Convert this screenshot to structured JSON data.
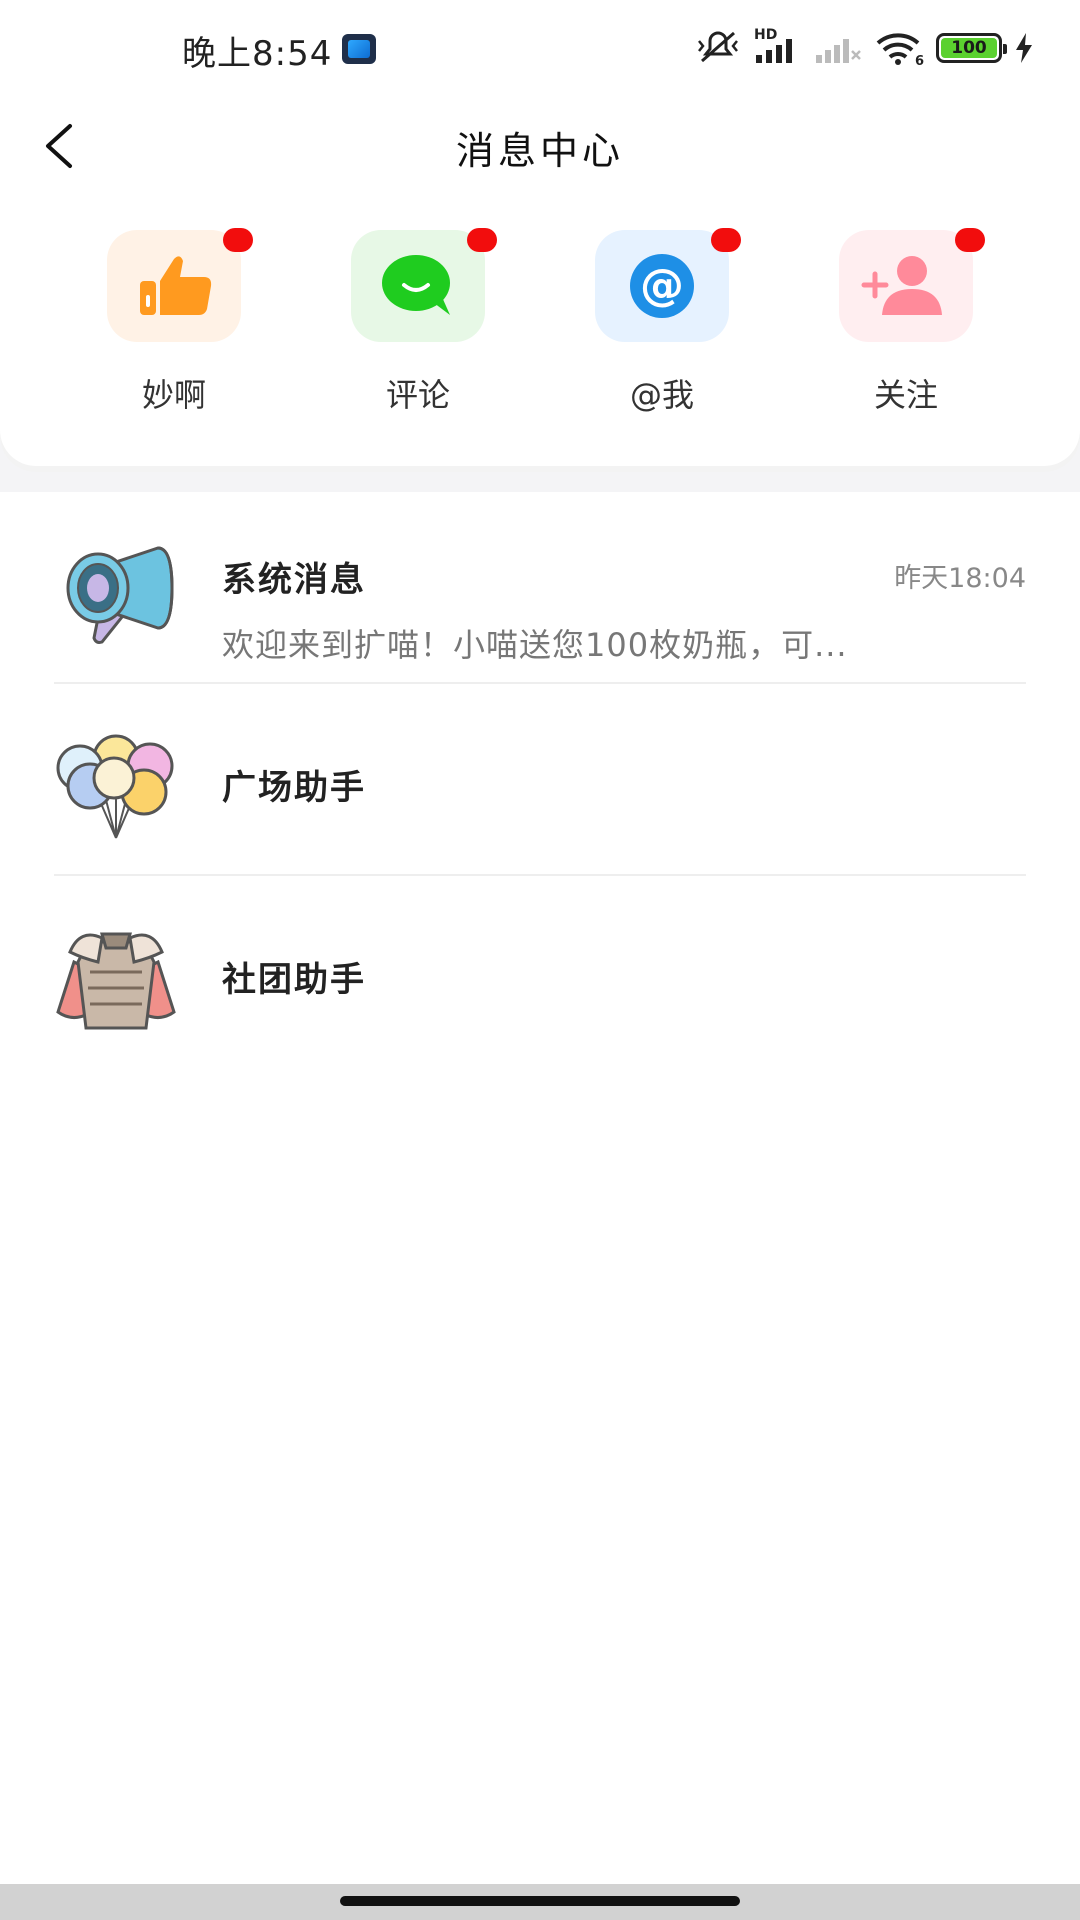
{
  "status_bar": {
    "time": "晚上8:54",
    "network_label": "HD",
    "wifi_label": "6",
    "battery_level": "100"
  },
  "header": {
    "title": "消息中心"
  },
  "shortcuts": [
    {
      "label": "妙啊",
      "icon": "thumbs-up-icon",
      "bg_color": "#fff2e6",
      "icon_color": "#ff9a1f",
      "has_badge": true
    },
    {
      "label": "评论",
      "icon": "chat-bubble-icon",
      "bg_color": "#e7f8e6",
      "icon_color": "#1fcc1f",
      "has_badge": true
    },
    {
      "label": "@我",
      "icon": "at-sign-icon",
      "bg_color": "#e6f2ff",
      "icon_color": "#1e8fe6",
      "has_badge": true
    },
    {
      "label": "关注",
      "icon": "add-user-icon",
      "bg_color": "#ffeef0",
      "icon_color": "#ff8a9a",
      "has_badge": true
    }
  ],
  "messages": [
    {
      "title": "系统消息",
      "time": "昨天18:04",
      "preview": "欢迎来到扩喵！小喵送您100枚奶瓶，可...",
      "avatar": "megaphone-icon"
    },
    {
      "title": "广场助手",
      "time": "",
      "preview": "",
      "avatar": "balloons-icon"
    },
    {
      "title": "社团助手",
      "time": "",
      "preview": "",
      "avatar": "armor-icon"
    }
  ],
  "colors": {
    "badge": "#f20d0d",
    "divider": "#eeeeee",
    "band": "#f4f4f6"
  }
}
